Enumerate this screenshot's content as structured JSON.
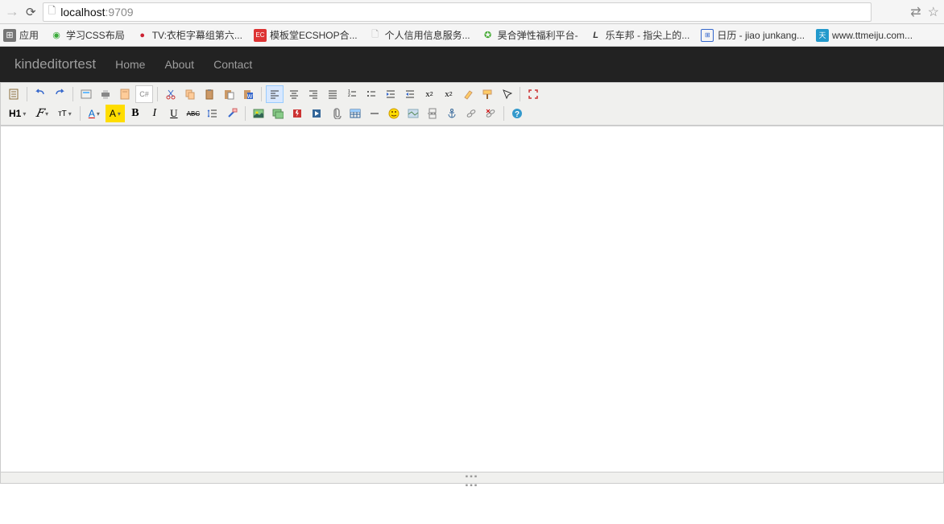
{
  "browser": {
    "url_host": "localhost",
    "url_port": ":9709"
  },
  "bookmarks": [
    {
      "label": "应用",
      "icon": "apps",
      "color": "#767676"
    },
    {
      "label": "学习CSS布局",
      "icon": "green",
      "color": "#3bab3b"
    },
    {
      "label": "TV:衣柜字幕组第六...",
      "icon": "red",
      "color": "#c23"
    },
    {
      "label": "模板堂ECSHOP合...",
      "icon": "ec",
      "color": "#d33"
    },
    {
      "label": "个人信用信息服务...",
      "icon": "page",
      "color": "#aaa"
    },
    {
      "label": "昊合弹性福利平台-",
      "icon": "h",
      "color": "#4a3"
    },
    {
      "label": "乐车邦 - 指尖上的...",
      "icon": "l",
      "color": "#333"
    },
    {
      "label": "日历 - jiao junkang...",
      "icon": "cal",
      "color": "#36c"
    },
    {
      "label": "www.ttmeiju.com...",
      "icon": "tt",
      "color": "#29c"
    }
  ],
  "nav": {
    "brand": "kindeditortest",
    "home": "Home",
    "about": "About",
    "contact": "Contact"
  },
  "fmt": {
    "h1": "H1",
    "font": "𝐹",
    "tt": "ᴛT",
    "a": "A",
    "a2": "A",
    "b": "B",
    "i": "I",
    "u": "U",
    "abc": "ABC"
  }
}
